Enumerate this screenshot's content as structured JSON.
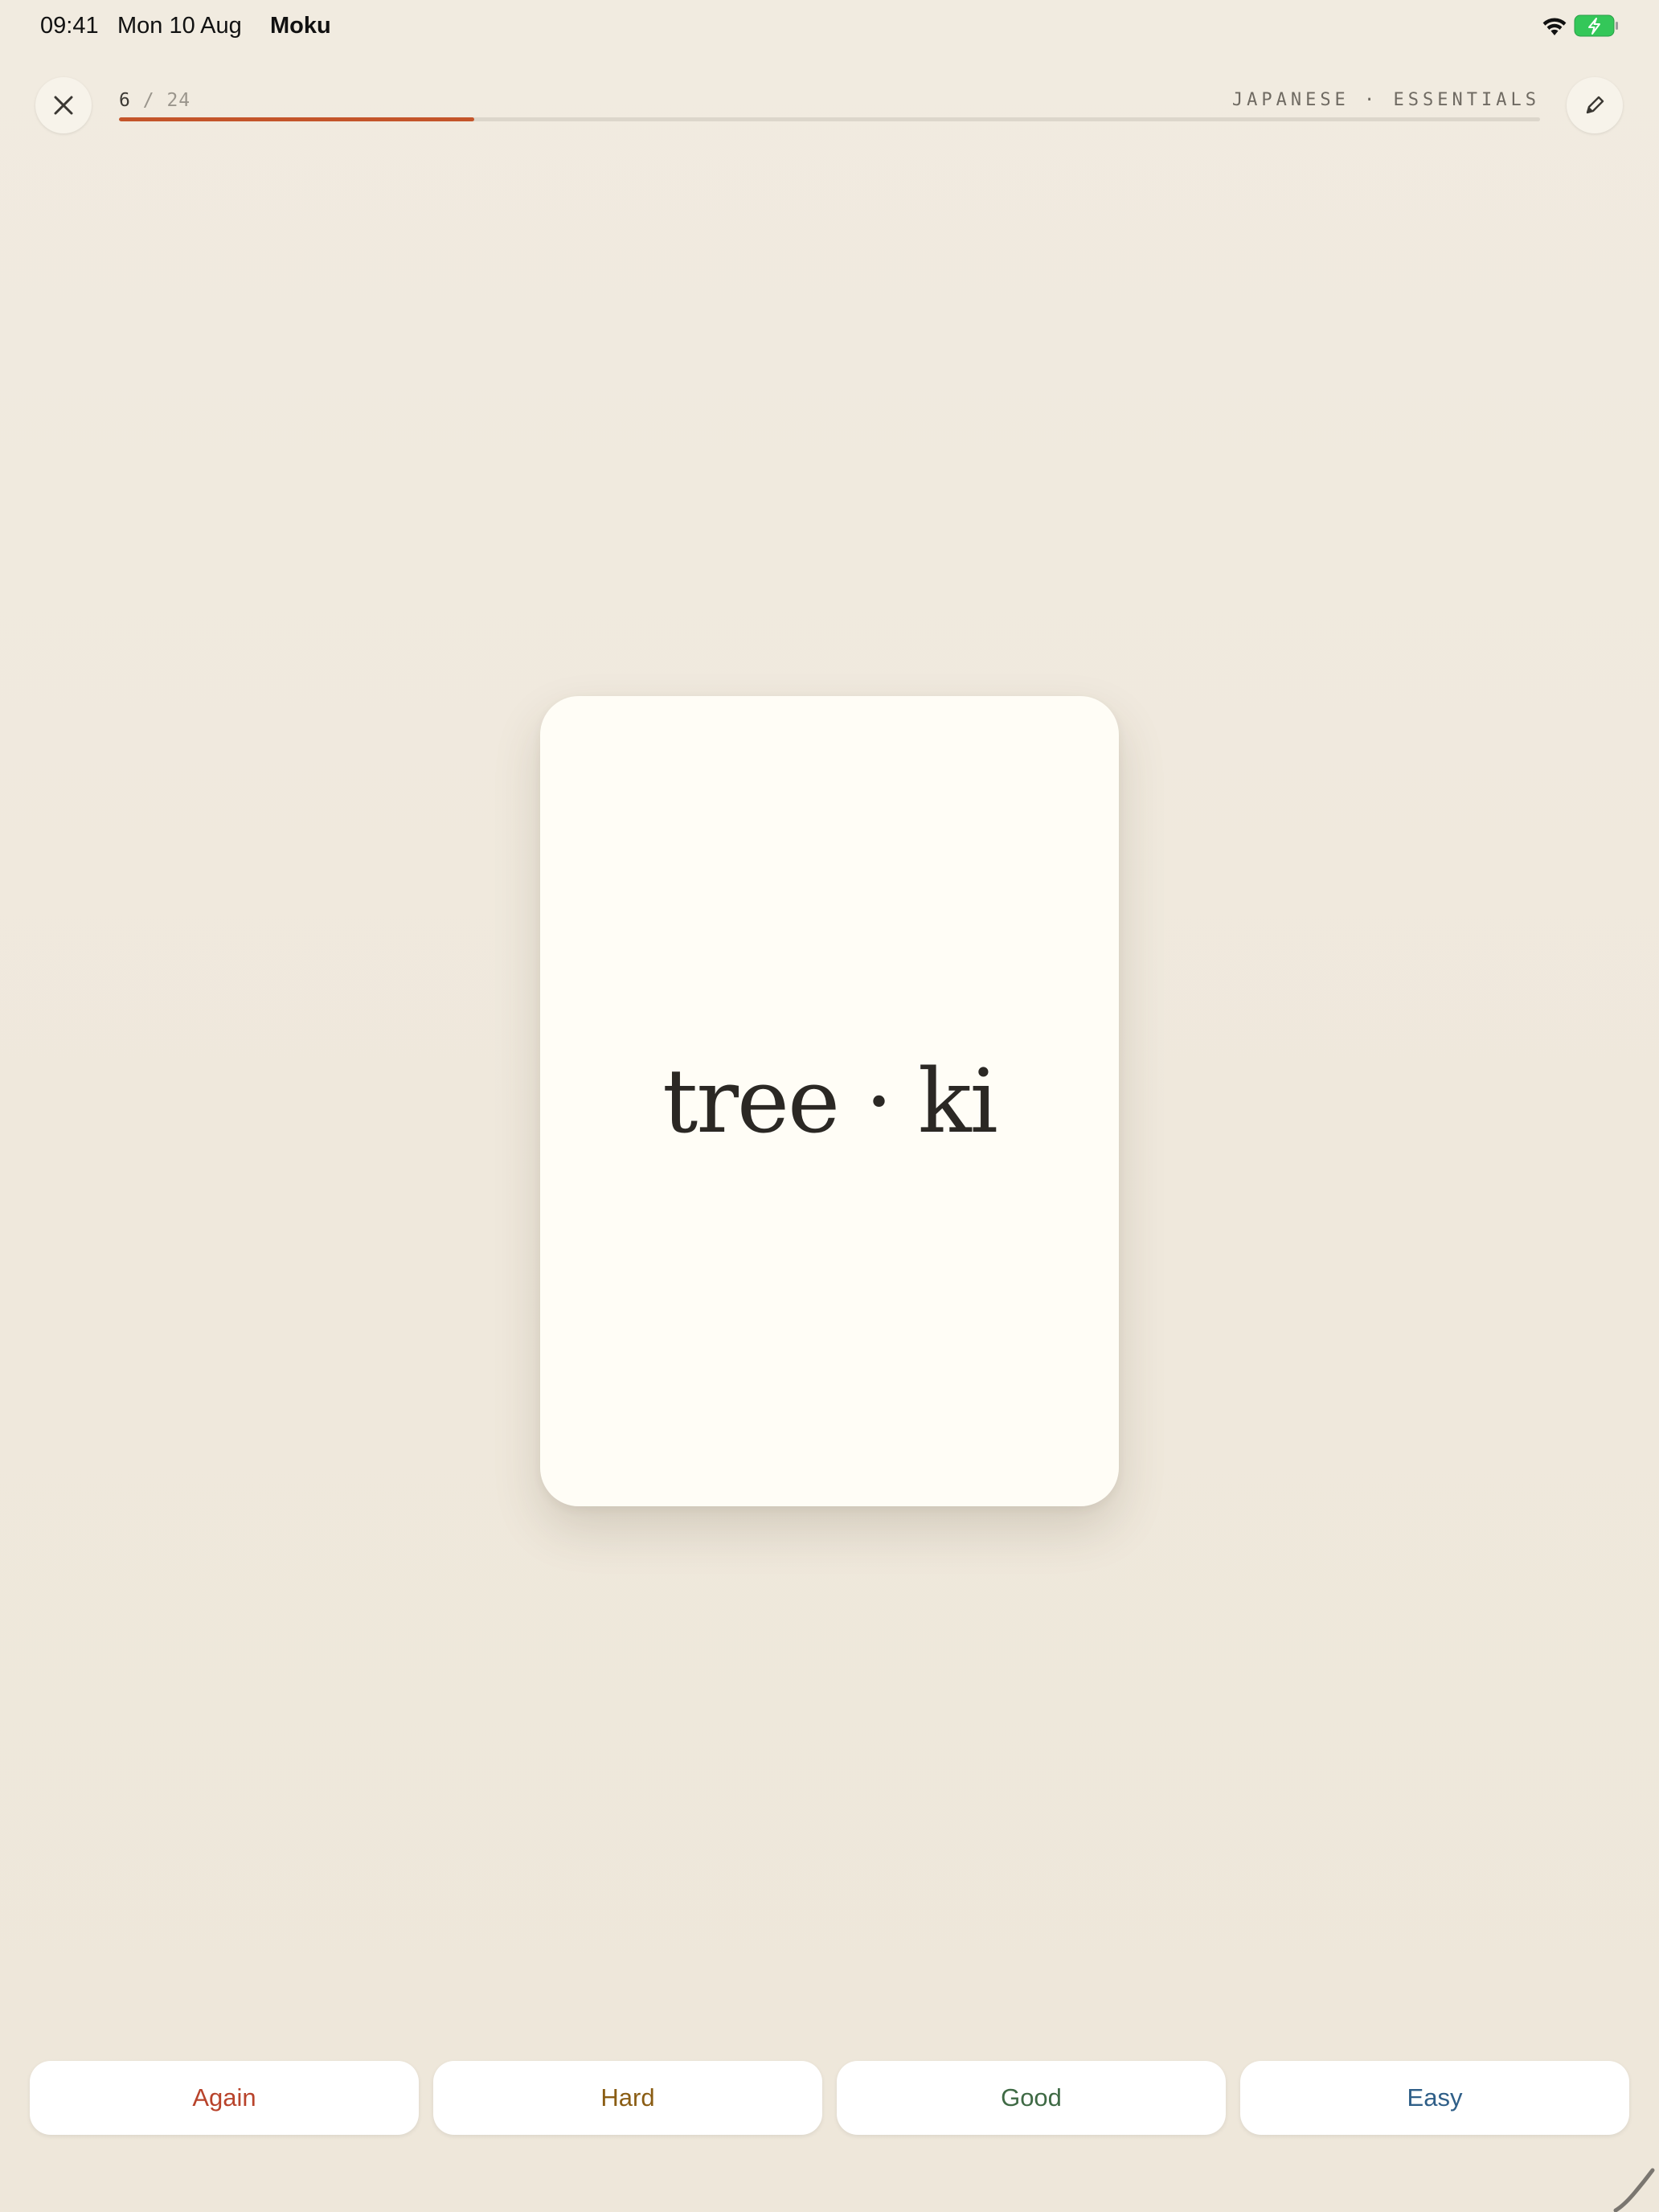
{
  "status_bar": {
    "time": "09:41",
    "date": "Mon 10 Aug",
    "app_name": "Moku",
    "battery_color": "#34c759"
  },
  "top_bar": {
    "close_icon": "close-icon",
    "edit_icon": "pencil-icon",
    "progress": {
      "current": "6",
      "separator": "/",
      "total": "24",
      "fraction": 0.25,
      "fill_color": "#c4552a"
    },
    "deck_label": "JAPANESE · ESSENTIALS"
  },
  "card": {
    "text": "tree · ki"
  },
  "answers": {
    "again": {
      "label": "Again",
      "color": "#b8432b"
    },
    "hard": {
      "label": "Hard",
      "color": "#8a5d14"
    },
    "good": {
      "label": "Good",
      "color": "#3f6a45"
    },
    "easy": {
      "label": "Easy",
      "color": "#2f5f88"
    }
  }
}
